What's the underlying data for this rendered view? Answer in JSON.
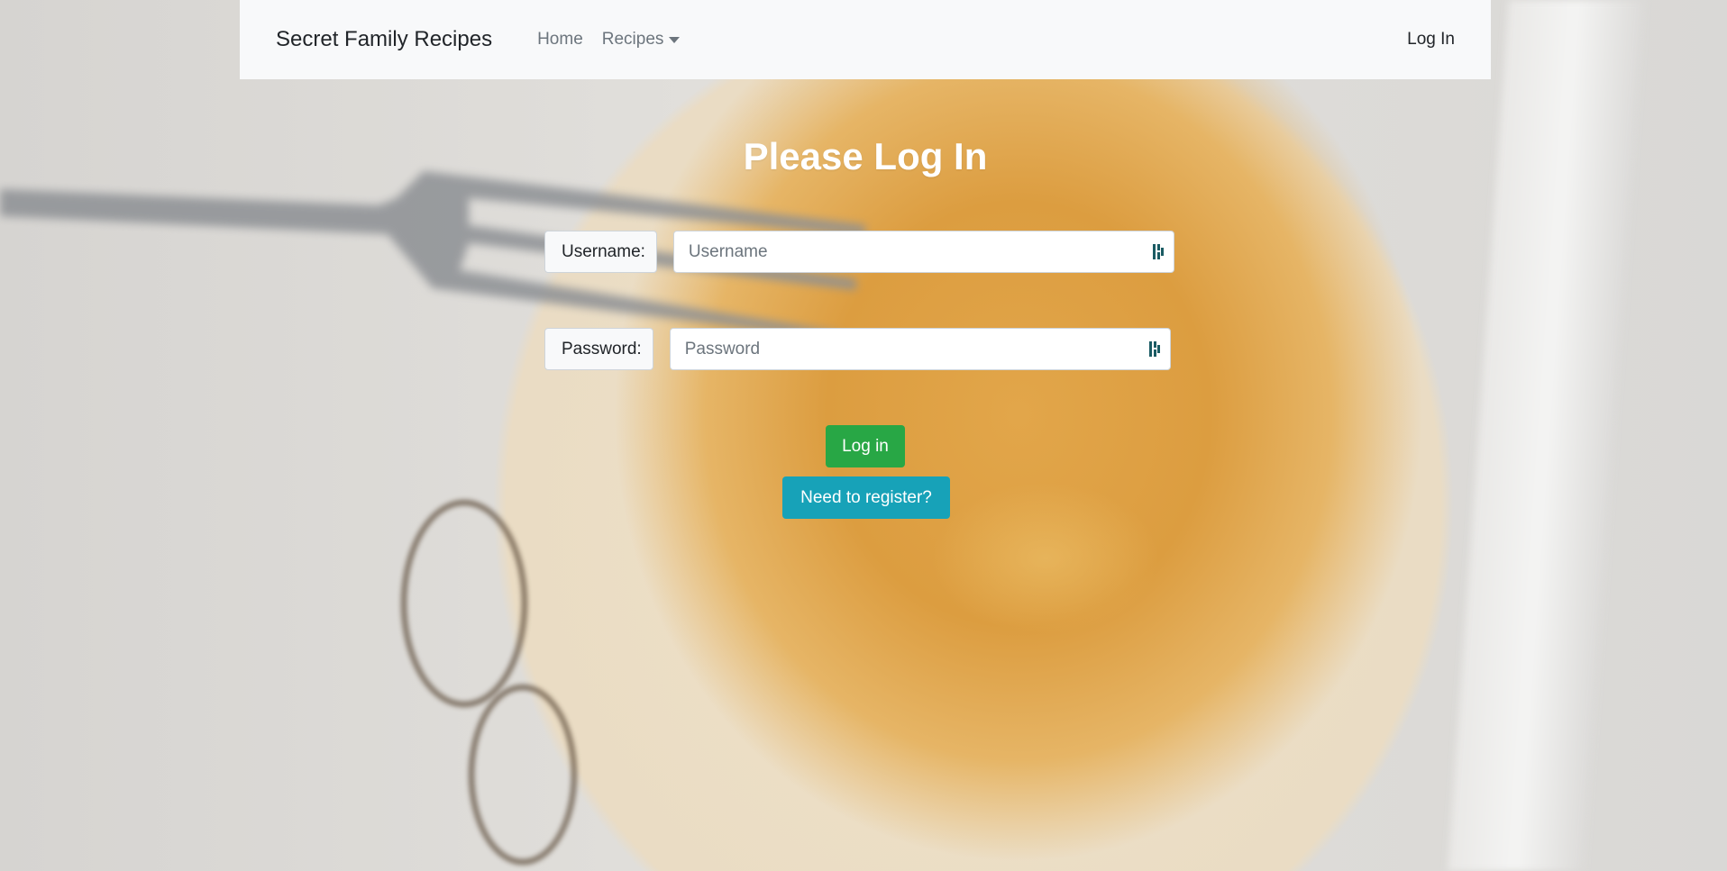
{
  "navbar": {
    "brand": "Secret Family Recipes",
    "links": [
      {
        "label": "Home"
      },
      {
        "label": "Recipes",
        "has_dropdown": true
      }
    ],
    "login_label": "Log In"
  },
  "login_form": {
    "title": "Please Log In",
    "username": {
      "label": "Username:",
      "placeholder": "Username",
      "value": ""
    },
    "password": {
      "label": "Password:",
      "placeholder": "Password",
      "value": ""
    },
    "login_button": "Log in",
    "register_button": "Need to register?"
  },
  "colors": {
    "navbar_bg": "#f8f9fa",
    "login_button": "#28a745",
    "register_button": "#17a2b8",
    "title_text": "#ffffff"
  },
  "icons": [
    "password-manager-icon",
    "chevron-down-icon"
  ]
}
